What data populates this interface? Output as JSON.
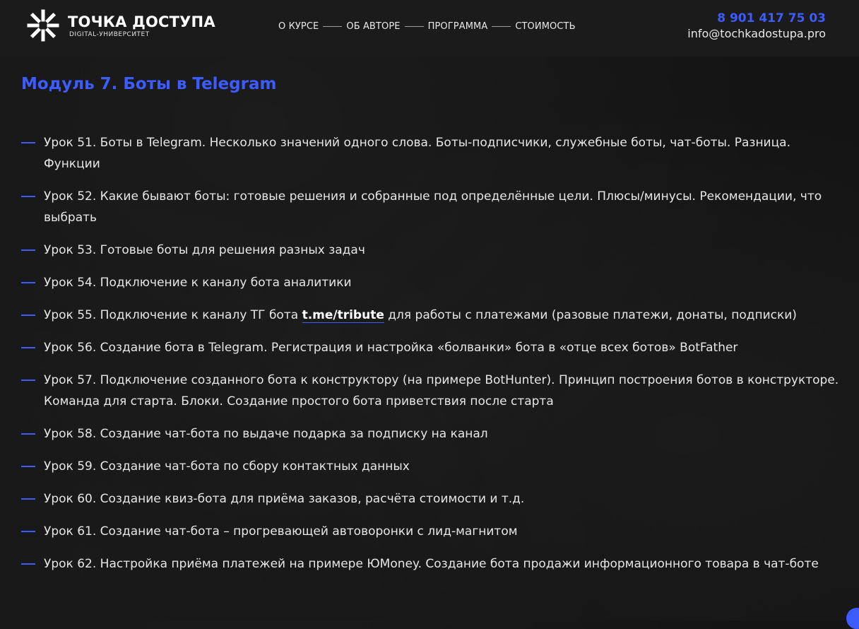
{
  "header": {
    "logo_title": "ТОЧКА ДОСТУПА",
    "logo_subtitle": "DIGITAL-УНИВЕРСИТЕТ",
    "nav": [
      {
        "label": "О КУРСЕ"
      },
      {
        "label": "ОБ АВТОРЕ"
      },
      {
        "label": "ПРОГРАММА"
      },
      {
        "label": "СТОИМОСТЬ"
      }
    ],
    "phone": "8 901 417 75 03",
    "email": "info@tochkadostupa.pro"
  },
  "module": {
    "title": "Модуль 7. Боты в Telegram",
    "lessons": [
      {
        "text": "Урок 51. Боты в Telegram. Несколько значений одного слова. Боты-подписчики, служебные боты, чат-боты. Разница. Функции"
      },
      {
        "text": "Урок 52. Какие бывают боты: готовые решения и собранные под определённые цели. Плюсы/минусы. Рекомендации, что выбрать"
      },
      {
        "text": "Урок 53. Готовые боты для решения разных задач"
      },
      {
        "text": "Урок 54. Подключение к каналу бота аналитики"
      },
      {
        "text_before": "Урок 55. Подключение к каналу ТГ бота ",
        "link": "t.me/tribute",
        "text_after": " для работы с платежами (разовые платежи, донаты, подписки)"
      },
      {
        "text": "Урок 56. Создание бота в Telegram. Регистрация и настройка «болванки» бота в «отце всех ботов» BotFather"
      },
      {
        "text": "Урок 57. Подключение созданного бота к конструктору (на примере BotHunter). Принцип построения ботов в конструкторе. Команда для старта. Блоки. Создание простого бота приветствия после старта"
      },
      {
        "text": "Урок 58. Создание чат-бота по выдаче подарка за подписку на канал"
      },
      {
        "text": "Урок 59. Создание чат-бота по сбору контактных данных"
      },
      {
        "text": "Урок 60. Создание квиз-бота для приёма заказов, расчёта стоимости и т.д."
      },
      {
        "text": "Урок 61. Создание чат-бота – прогревающей автоворонки с лид-магнитом"
      },
      {
        "text": "Урок 62. Настройка приёма платежей на примере ЮMoney. Создание бота продажи информационного товара в чат-боте"
      }
    ]
  },
  "colors": {
    "accent": "#3d5cff",
    "background": "#141414",
    "header_bg": "#1b1b1b",
    "text": "#e6e6e6"
  },
  "icons": {
    "logo": "starburst-logo-icon",
    "chat": "chat-bubble-icon"
  }
}
